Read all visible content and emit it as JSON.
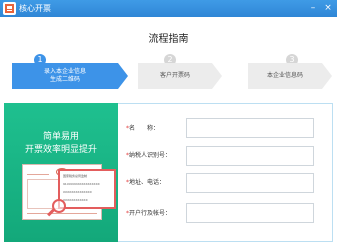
{
  "window": {
    "title": "核心开票",
    "minimize_symbol": "–",
    "close_symbol": "×"
  },
  "guide": {
    "title": "流程指南",
    "steps": [
      {
        "number": "1",
        "label_line1": "录入本企业信息",
        "label_line2": "生成二维码",
        "state": "active"
      },
      {
        "number": "2",
        "label": "客户开票码",
        "state": "inactive"
      },
      {
        "number": "3",
        "label": "本企业信息码",
        "state": "inactive"
      }
    ]
  },
  "promo": {
    "title": "简单易用",
    "subtitle": "开票效率明显提升",
    "callout_rows": [
      "国家税务总局监制",
      "91XXXXXXXXXXXXXXXX",
      "XXXXXXXXXXXXXX",
      "XXXXXXXXXXXX"
    ]
  },
  "form": {
    "fields": [
      {
        "label": "名　　称：",
        "value": ""
      },
      {
        "label": "纳税人识别号：",
        "value": ""
      },
      {
        "label": "地址、电话：",
        "value": ""
      },
      {
        "label": "开户行及帐号：",
        "value": ""
      }
    ],
    "required_mark": "*"
  },
  "colors": {
    "titlebar": "#2f86d6",
    "accent": "#3d93e8",
    "promo_green": "#13a87a",
    "required_red": "#e23b3b"
  }
}
